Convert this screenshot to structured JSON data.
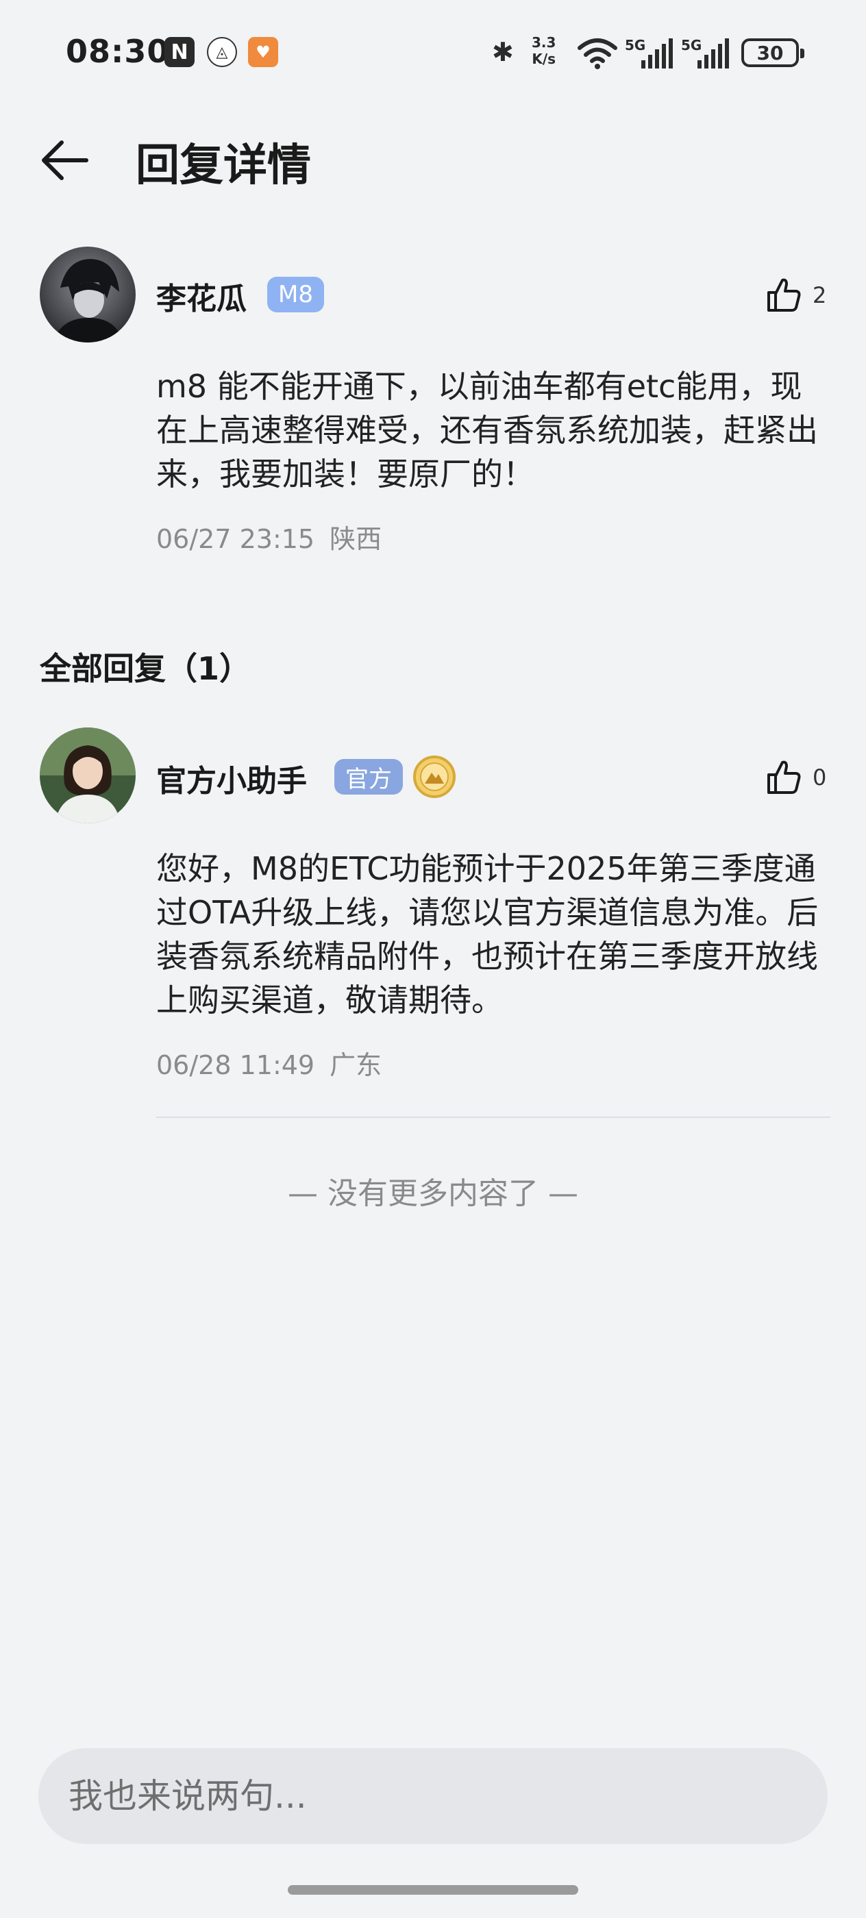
{
  "status_bar": {
    "time": "08:30",
    "nfc_glyph": "N",
    "app1_glyph": "◬",
    "app2_glyph": "♥",
    "bluetooth_glyph": "✱",
    "net_speed_value": "3.3",
    "net_speed_unit": "K/s",
    "signal1_label": "5G",
    "signal2_label": "5G",
    "battery_level": "30",
    "icons": [
      "nfc-icon",
      "app-icon",
      "app-icon",
      "bluetooth-icon",
      "wifi-icon",
      "signal-icon",
      "signal-icon",
      "battery-icon"
    ]
  },
  "header": {
    "title": "回复详情",
    "back_icon": "back-arrow-icon"
  },
  "main_comment": {
    "username": "李花瓜",
    "badge": "M8",
    "badge_color": "#8fb3f2",
    "like_count": "2",
    "content": "m8 能不能开通下，以前油车都有etc能用，现在上高速整得难受，还有香氛系统加装，赶紧出来，我要加装！要原厂的！",
    "date": "06/27 23:15",
    "location": "陕西"
  },
  "replies_section": {
    "title": "全部回复（1）"
  },
  "replies": [
    {
      "username": "官方小助手",
      "badge": "官方",
      "badge_color": "#8aa6e0",
      "medal_icon": "gold-medal-icon",
      "like_count": "0",
      "content": "您好，M8的ETC功能预计于2025年第三季度通过OTA升级上线，请您以官方渠道信息为准。后装香氛系统精品附件，也预计在第三季度开放线上购买渠道，敬请期待。",
      "date": "06/28 11:49",
      "location": "广东"
    }
  ],
  "footer": {
    "no_more_text": "— 没有更多内容了 —",
    "input_placeholder": "我也来说两句..."
  }
}
